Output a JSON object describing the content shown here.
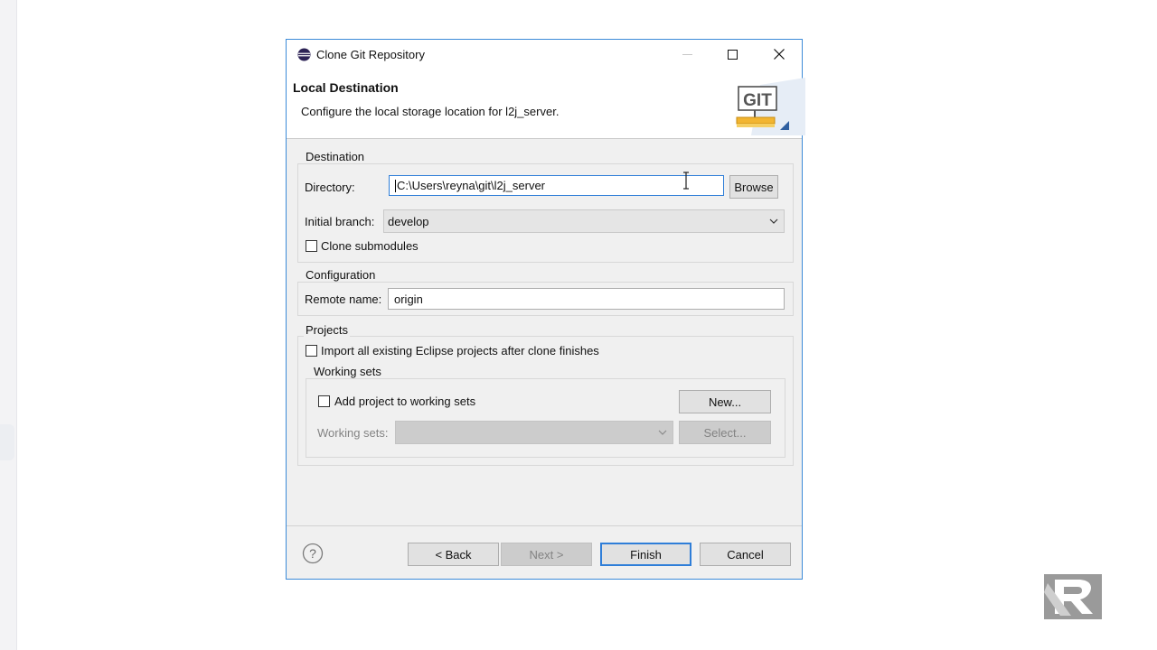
{
  "dialog": {
    "title": "Clone Git Repository",
    "header_title": "Local Destination",
    "header_description": "Configure the local storage location for l2j_server.",
    "git_logo_text": "GIT"
  },
  "destination": {
    "group_label": "Destination",
    "directory_label": "Directory:",
    "directory_value": "C:\\Users\\reyna\\git\\l2j_server",
    "browse_label": "Browse",
    "initial_branch_label": "Initial branch:",
    "initial_branch_value": "develop",
    "clone_submodules_label": "Clone submodules",
    "clone_submodules_checked": false
  },
  "configuration": {
    "group_label": "Configuration",
    "remote_name_label": "Remote name:",
    "remote_name_value": "origin"
  },
  "projects": {
    "group_label": "Projects",
    "import_label": "Import all existing Eclipse projects after clone finishes",
    "import_checked": false,
    "working_sets_group_label": "Working sets",
    "add_to_working_sets_label": "Add project to working sets",
    "add_to_working_sets_checked": false,
    "new_button_label": "New...",
    "working_sets_label": "Working sets:",
    "working_sets_value": "",
    "select_button_label": "Select..."
  },
  "footer": {
    "back_label": "< Back",
    "next_label": "Next >",
    "finish_label": "Finish",
    "cancel_label": "Cancel"
  },
  "colors": {
    "accent": "#2f7ed8",
    "dialog_bg": "#f0f0f0",
    "border": "#3c8ad8"
  }
}
